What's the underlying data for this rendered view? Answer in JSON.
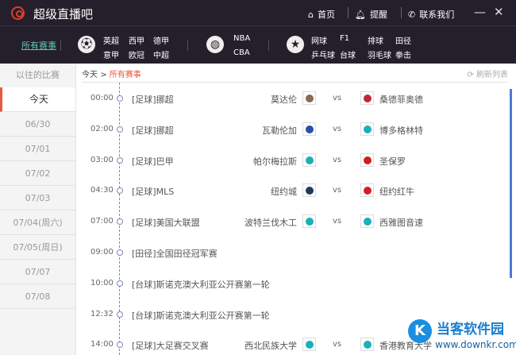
{
  "app": {
    "title": "超级直播吧",
    "nav": [
      {
        "icon": "home-icon",
        "label": "首页"
      },
      {
        "icon": "bell-icon",
        "label": "提醒"
      },
      {
        "icon": "phone-icon",
        "label": "联系我们"
      }
    ],
    "minimize": "—",
    "close": "✕"
  },
  "navbar": {
    "all": "所有赛事",
    "football": [
      "英超",
      "西甲",
      "德甲",
      "意甲",
      "欧冠",
      "中超"
    ],
    "basketball": [
      "NBA",
      "CBA"
    ],
    "other": [
      "网球",
      "F1",
      "排球",
      "田径",
      "乒乓球",
      "台球",
      "羽毛球",
      "拳击"
    ]
  },
  "sidebar": {
    "header": "以往的比赛",
    "items": [
      "今天",
      "06/30",
      "07/01",
      "07/02",
      "07/03",
      "07/04(周六)",
      "07/05(周日)",
      "07/07",
      "07/08"
    ]
  },
  "main": {
    "breadcrumb_root": "今天",
    "breadcrumb_sep": ">",
    "breadcrumb_current": "所有赛事",
    "refresh": "刷新列表",
    "vs": "vs",
    "matches": [
      {
        "time": "00:00",
        "category": "[足球]挪超",
        "home": "莫达伦",
        "away": "桑德菲奥德",
        "home_color": "#8a6a50",
        "away_color": "#c0283a"
      },
      {
        "time": "02:00",
        "category": "[足球]挪超",
        "home": "瓦勒伦加",
        "away": "博多格林特",
        "home_color": "#2850a8",
        "away_color": "#1ab0b8"
      },
      {
        "time": "03:00",
        "category": "[足球]巴甲",
        "home": "帕尔梅拉斯",
        "away": "圣保罗",
        "home_color": "#1ab0b8",
        "away_color": "#cc2020"
      },
      {
        "time": "04:30",
        "category": "[足球]MLS",
        "home": "纽约城",
        "away": "纽约红牛",
        "home_color": "#223a5a",
        "away_color": "#d02030"
      },
      {
        "time": "07:00",
        "category": "[足球]美国大联盟",
        "home": "波特兰伐木工",
        "away": "西雅图音速",
        "home_color": "#1ab0b8",
        "away_color": "#1ab0b8"
      },
      {
        "time": "09:00",
        "category": "[田径]全国田径冠军赛"
      },
      {
        "time": "10:00",
        "category": "[台球]斯诺克澳大利亚公开赛第一轮"
      },
      {
        "time": "12:32",
        "category": "[台球]斯诺克澳大利亚公开赛第一轮"
      },
      {
        "time": "14:00",
        "category": "[足球]大足赛交叉赛",
        "home": "西北民族大学",
        "away": "香港教育大学",
        "home_color": "#1ab0b8",
        "away_color": "#1ab0b8"
      }
    ]
  },
  "watermark": {
    "name": "当客软件园",
    "url": "www.downkr.com"
  }
}
